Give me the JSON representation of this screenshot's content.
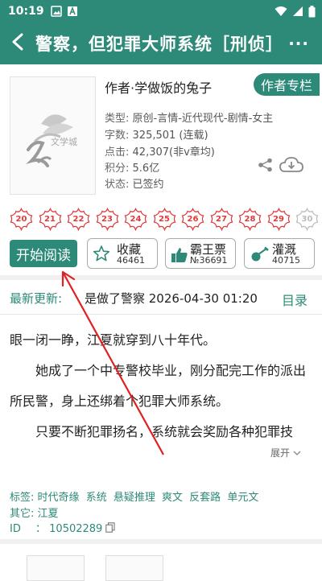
{
  "status_bar": {
    "time": "10:19"
  },
  "app_bar": {
    "back": "<",
    "title": "警察，但犯罪大师系统［刑侦］",
    "more": "···"
  },
  "book": {
    "author_line": "作者·学做饭的兔子",
    "author_column": "作者专栏",
    "cover_text": "文学城",
    "type_label": "类型:",
    "type": "原创-言情-近代现代-剧情-女主",
    "words_label": "字数:",
    "words": "325,501 (连载)",
    "clicks_label": "点击:",
    "clicks": "42,307(非v章均)",
    "points_label": "积分:",
    "points": "5.6亿",
    "status_label": "状态:",
    "status": "已签约"
  },
  "flowers": [
    "20",
    "21",
    "22",
    "23",
    "24",
    "25",
    "26",
    "27",
    "28",
    "29",
    "30"
  ],
  "actions": {
    "read": "开始阅读",
    "favorite": {
      "label": "收藏",
      "count": "46461"
    },
    "bawang": {
      "label": "霸王票",
      "count": "№36691"
    },
    "water": {
      "label": "灌溉",
      "count": "40715"
    }
  },
  "latest": {
    "label": "最新更新:",
    "title": "是做了警察 2026-04-30 01:20",
    "toc": "目录"
  },
  "intro": {
    "p1": "眼一闭一睁，江夏就穿到八十年代。",
    "p2": "　　她成了一个中专警校毕业，刚分配完工作的派出所民警，身上还绑着个犯罪大师系统。",
    "p3": "　　只要不断犯罪扬名，系统就会奖励各种犯罪技",
    "expand": "展开"
  },
  "tags": {
    "label": "标签:",
    "items": [
      "时代奇缘",
      "系统",
      "悬疑推理",
      "爽文",
      "反套路",
      "单元文"
    ]
  },
  "other": {
    "label": "其它:",
    "value": "江夏"
  },
  "id": {
    "label": "ID",
    "colon": "：",
    "value": "10502289"
  },
  "colors": {
    "primary": "#2e8a78",
    "flower": "#e03a3a",
    "arrow": "#e02020"
  }
}
